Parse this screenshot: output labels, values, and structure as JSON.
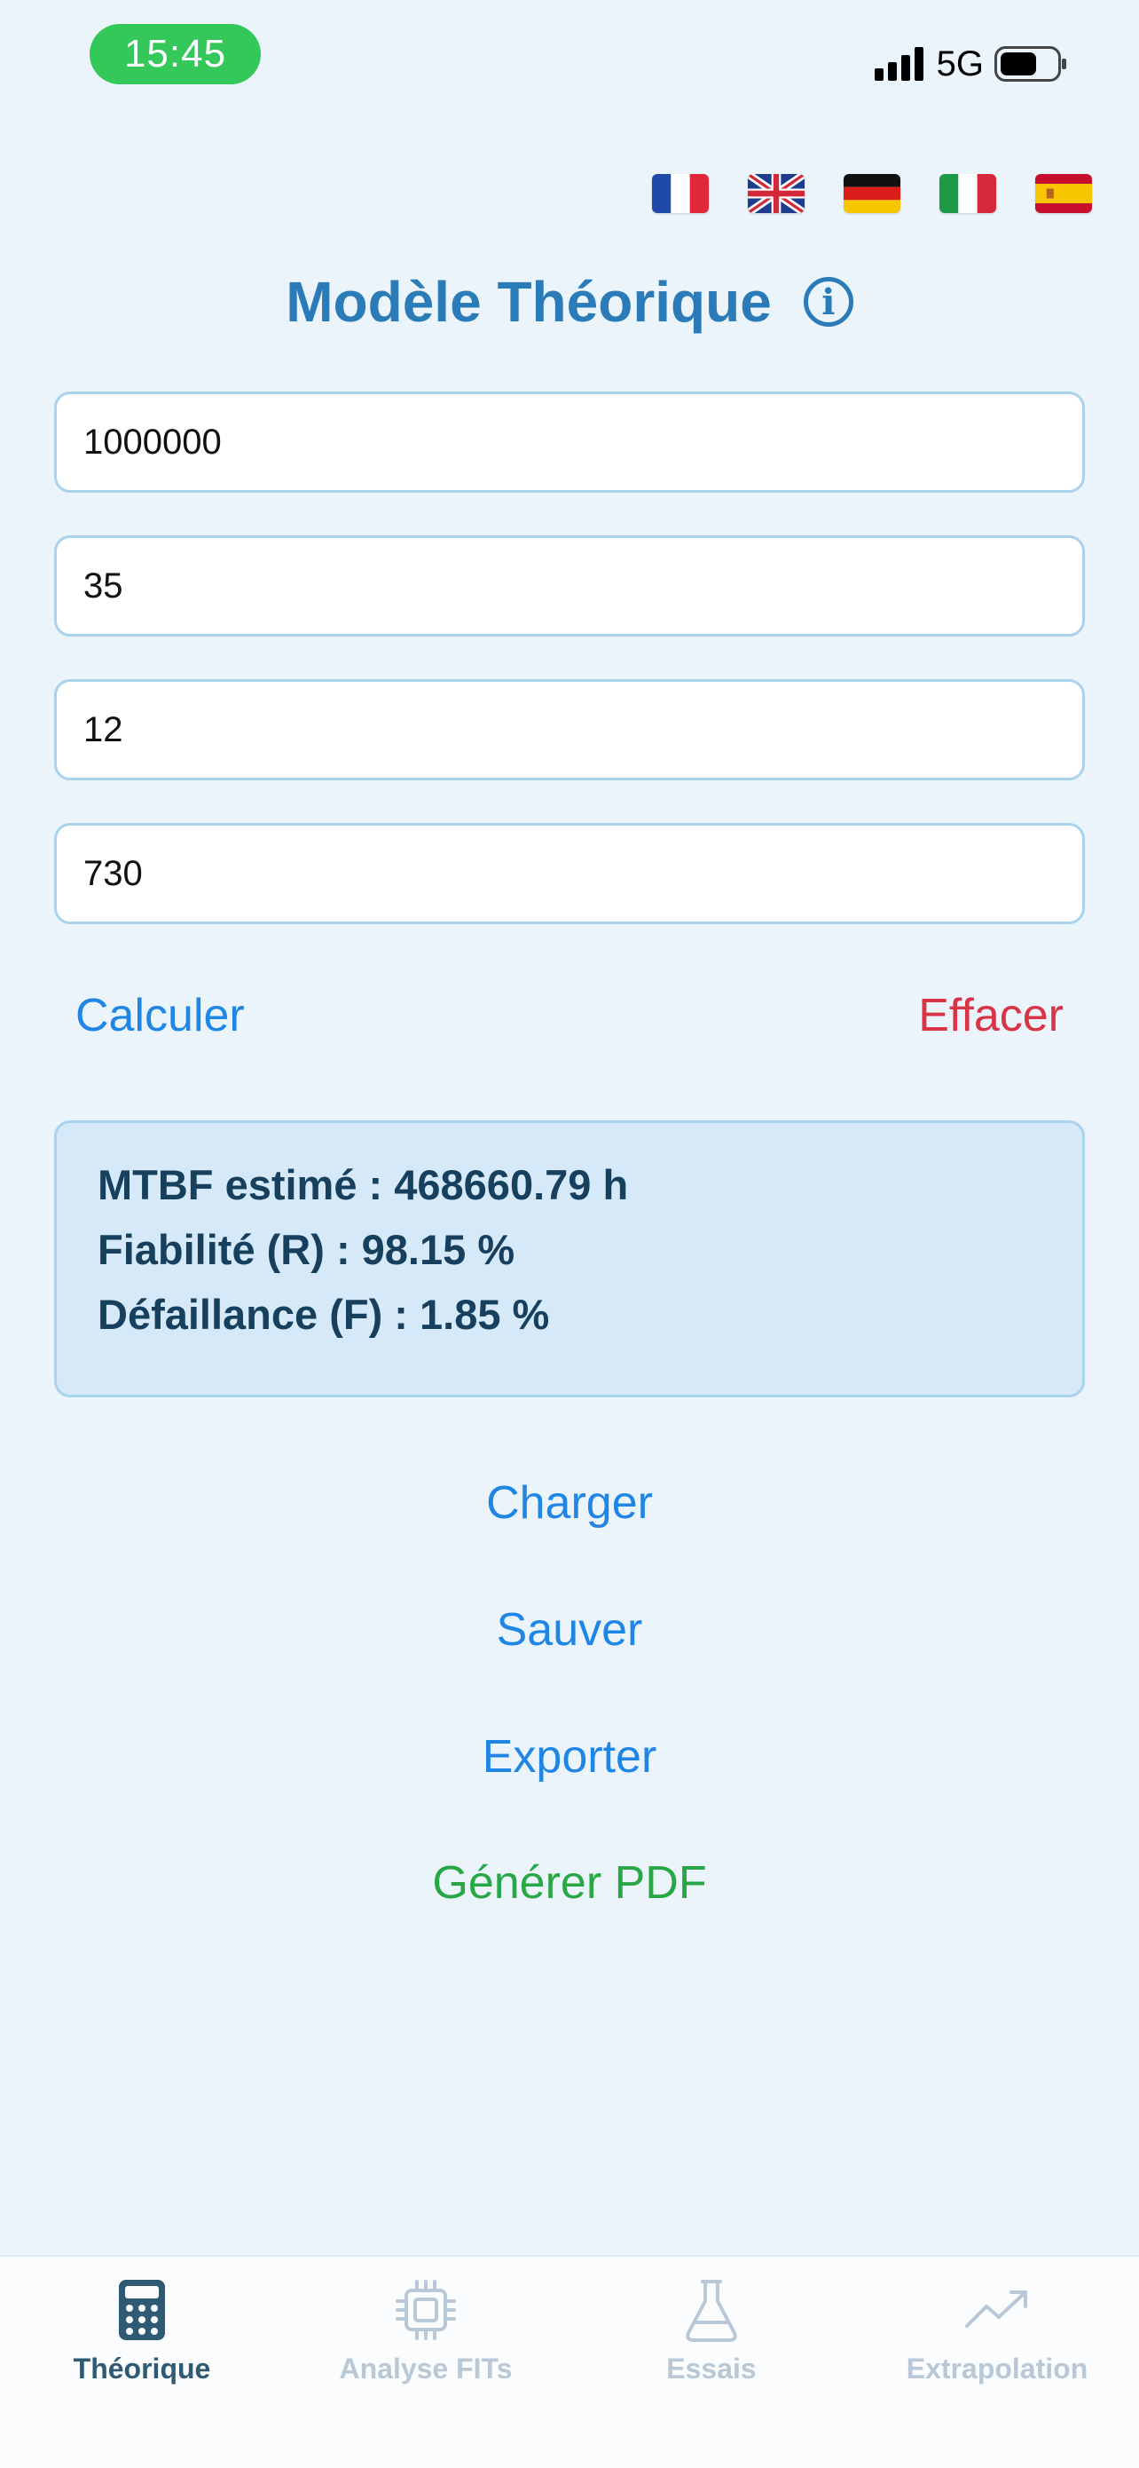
{
  "status_bar": {
    "time": "15:45",
    "network": "5G"
  },
  "flags": [
    {
      "name": "flag-fr-icon",
      "lang": "fr"
    },
    {
      "name": "flag-uk-icon",
      "lang": "en"
    },
    {
      "name": "flag-de-icon",
      "lang": "de"
    },
    {
      "name": "flag-it-icon",
      "lang": "it"
    },
    {
      "name": "flag-es-icon",
      "lang": "es"
    }
  ],
  "header": {
    "title": "Modèle Théorique",
    "info_icon": "i"
  },
  "fields": {
    "field1": {
      "value": "1000000"
    },
    "field2": {
      "value": "35"
    },
    "field3": {
      "value": "12"
    },
    "field4": {
      "value": "730"
    }
  },
  "actions": {
    "calculate": "Calculer",
    "clear": "Effacer"
  },
  "results": {
    "mtbf": "MTBF estimé : 468660.79 h",
    "reliability": "Fiabilité (R) : 98.15 %",
    "failure": "Défaillance (F) : 1.85 %"
  },
  "file_actions": {
    "load": "Charger",
    "save": "Sauver",
    "export": "Exporter",
    "pdf": "Générer PDF"
  },
  "tabs": [
    {
      "label": "Théorique",
      "icon": "calculator-icon",
      "active": true
    },
    {
      "label": "Analyse FITs",
      "icon": "chip-icon",
      "active": false
    },
    {
      "label": "Essais",
      "icon": "flask-icon",
      "active": false
    },
    {
      "label": "Extrapolation",
      "icon": "trend-up-icon",
      "active": false
    }
  ],
  "colors": {
    "accent": "#1f86e6",
    "title": "#2a7bb8",
    "danger": "#d93445",
    "success": "#28a745",
    "status_green": "#34c759"
  }
}
